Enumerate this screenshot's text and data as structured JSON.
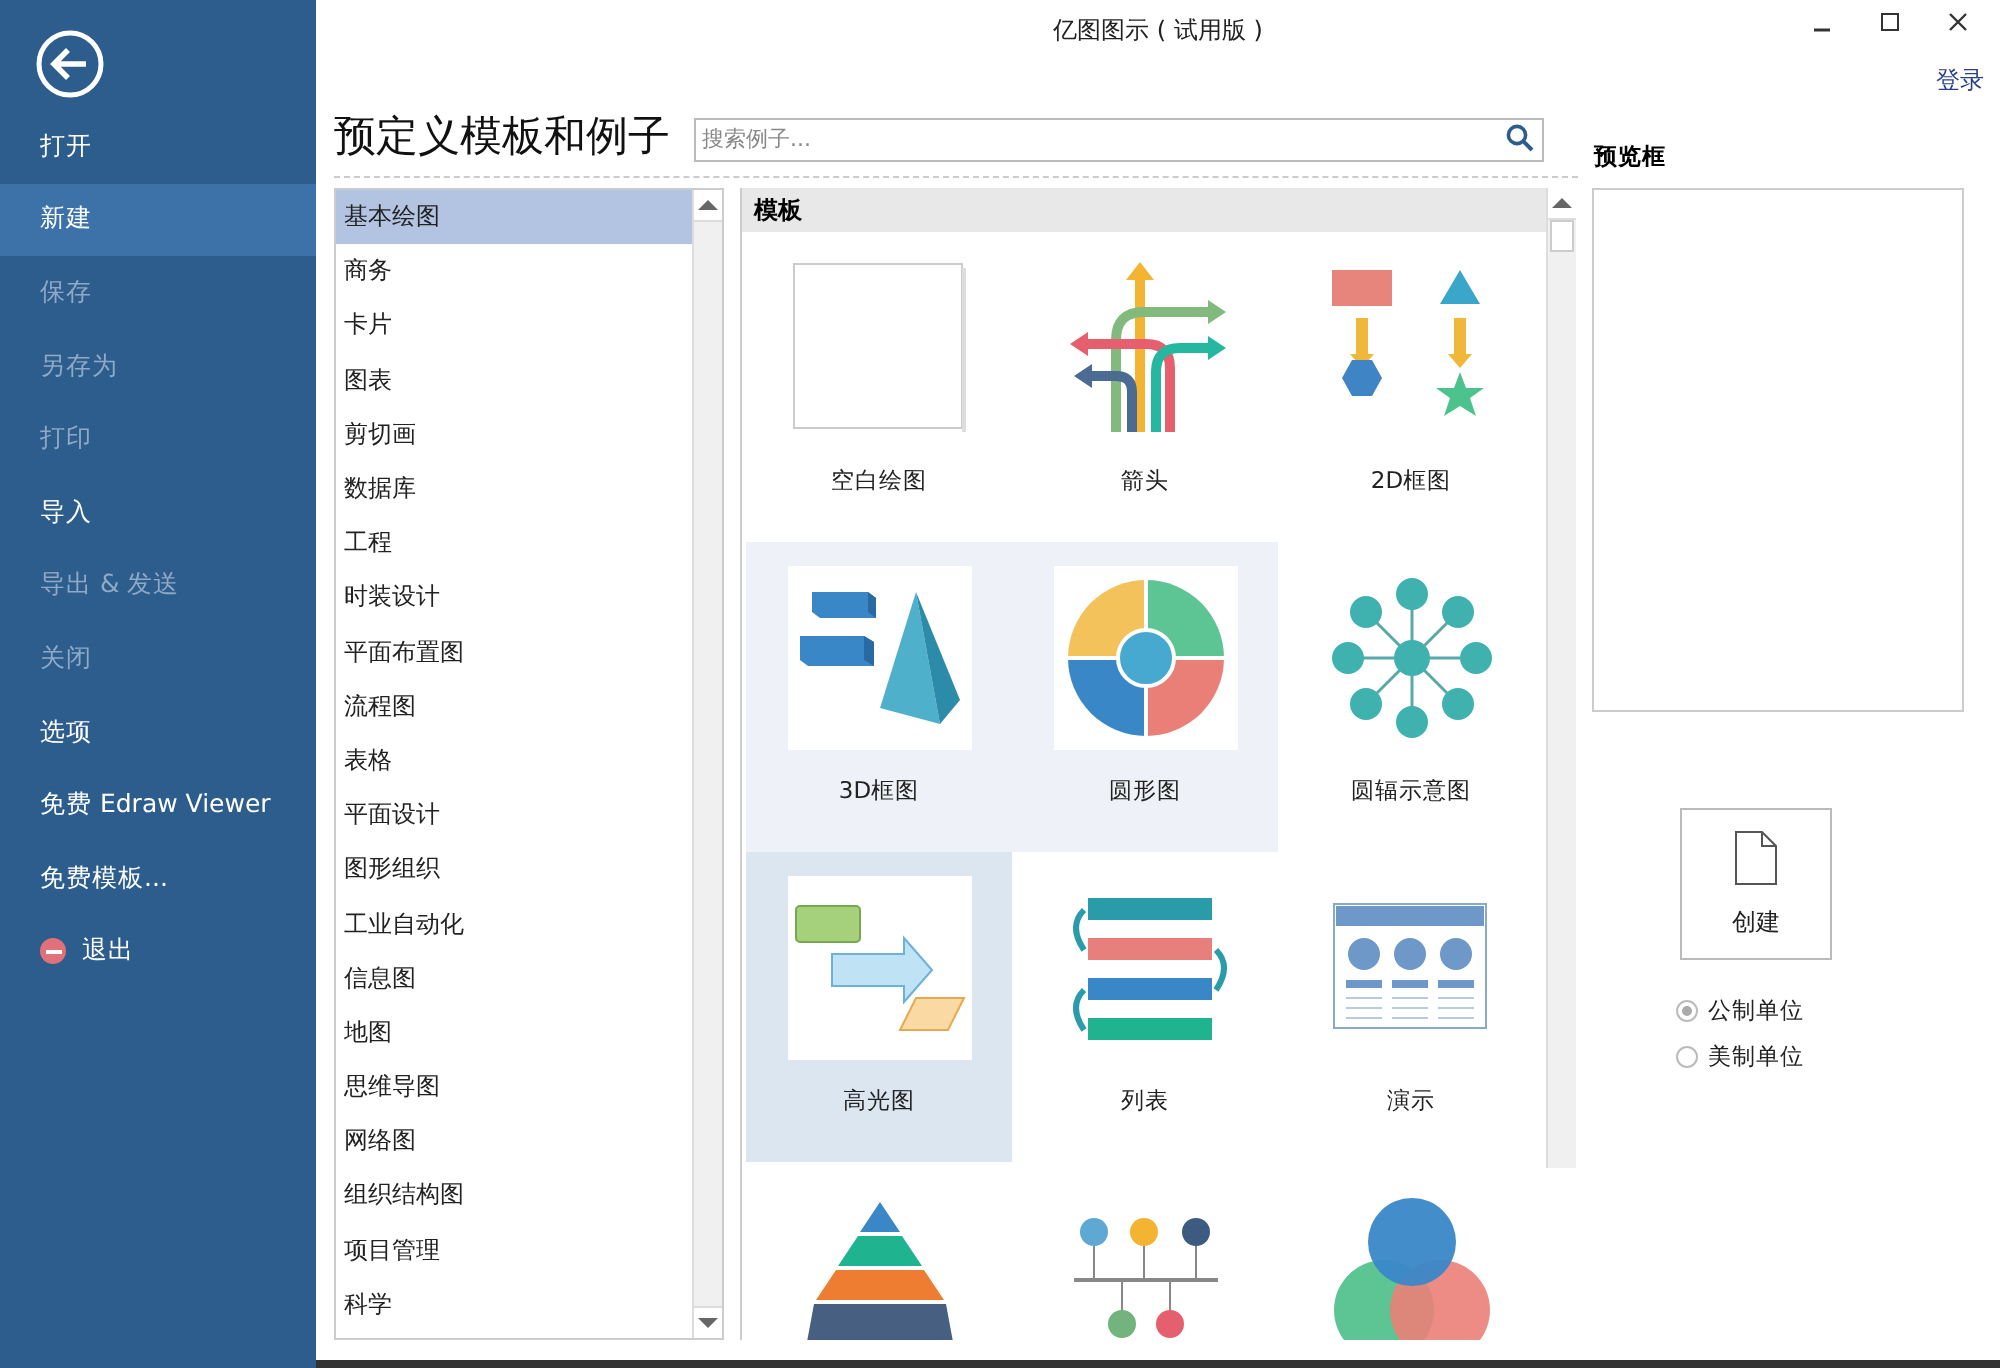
{
  "window": {
    "title": "亿图图示 ( 试用版 )",
    "login": "登录"
  },
  "sidebar": {
    "items": [
      {
        "label": "打开",
        "kind": "plain",
        "selected": false,
        "disabled": false
      },
      {
        "label": "新建",
        "kind": "plain",
        "selected": true,
        "disabled": false
      },
      {
        "label": "保存",
        "kind": "plain",
        "selected": false,
        "disabled": true
      },
      {
        "label": "另存为",
        "kind": "plain",
        "selected": false,
        "disabled": true
      },
      {
        "label": "打印",
        "kind": "plain",
        "selected": false,
        "disabled": true
      },
      {
        "label": "导入",
        "kind": "plain",
        "selected": false,
        "disabled": false
      },
      {
        "label": "导出 & 发送",
        "kind": "plain",
        "selected": false,
        "disabled": true
      },
      {
        "label": "关闭",
        "kind": "plain",
        "selected": false,
        "disabled": true
      },
      {
        "label": "选项",
        "kind": "plain",
        "selected": false,
        "disabled": false
      },
      {
        "label": "免费 Edraw Viewer",
        "kind": "plain",
        "selected": false,
        "disabled": false
      },
      {
        "label": "免费模板...",
        "kind": "plain",
        "selected": false,
        "disabled": false
      },
      {
        "label": "退出",
        "kind": "exit",
        "selected": false,
        "disabled": false
      }
    ]
  },
  "heading": "预定义模板和例子",
  "search": {
    "placeholder": "搜索例子..."
  },
  "categories": [
    {
      "label": "基本绘图",
      "selected": true
    },
    {
      "label": "商务",
      "selected": false
    },
    {
      "label": "卡片",
      "selected": false
    },
    {
      "label": "图表",
      "selected": false
    },
    {
      "label": "剪切画",
      "selected": false
    },
    {
      "label": "数据库",
      "selected": false
    },
    {
      "label": "工程",
      "selected": false
    },
    {
      "label": "时装设计",
      "selected": false
    },
    {
      "label": "平面布置图",
      "selected": false
    },
    {
      "label": "流程图",
      "selected": false
    },
    {
      "label": "表格",
      "selected": false
    },
    {
      "label": "平面设计",
      "selected": false
    },
    {
      "label": "图形组织",
      "selected": false
    },
    {
      "label": "工业自动化",
      "selected": false
    },
    {
      "label": "信息图",
      "selected": false
    },
    {
      "label": "地图",
      "selected": false
    },
    {
      "label": "思维导图",
      "selected": false
    },
    {
      "label": "网络图",
      "selected": false
    },
    {
      "label": "组织结构图",
      "selected": false
    },
    {
      "label": "项目管理",
      "selected": false
    },
    {
      "label": "科学",
      "selected": false
    }
  ],
  "templates": {
    "header": "模板",
    "items": [
      {
        "label": "空白绘图",
        "kind": "blank",
        "selected": false,
        "hovered": false
      },
      {
        "label": "箭头",
        "kind": "arrows",
        "selected": false,
        "hovered": false
      },
      {
        "label": "2D框图",
        "kind": "shapes2d",
        "selected": false,
        "hovered": false
      },
      {
        "label": "3D框图",
        "kind": "shapes3d",
        "selected": false,
        "hovered": true
      },
      {
        "label": "圆形图",
        "kind": "circle",
        "selected": false,
        "hovered": true
      },
      {
        "label": "圆辐示意图",
        "kind": "radial",
        "selected": false,
        "hovered": false
      },
      {
        "label": "高光图",
        "kind": "highlight",
        "selected": true,
        "hovered": false
      },
      {
        "label": "列表",
        "kind": "list",
        "selected": false,
        "hovered": false
      },
      {
        "label": "演示",
        "kind": "presentation",
        "selected": false,
        "hovered": false
      },
      {
        "kind": "pyramid",
        "selected": false,
        "hovered": false
      },
      {
        "kind": "timeline",
        "selected": false,
        "hovered": false
      },
      {
        "kind": "venn",
        "selected": false,
        "hovered": false
      }
    ]
  },
  "preview": {
    "label": "预览框"
  },
  "create_button": {
    "label": "创建"
  },
  "units": [
    {
      "label": "公制单位",
      "selected": true
    },
    {
      "label": "美制单位",
      "selected": false
    }
  ]
}
